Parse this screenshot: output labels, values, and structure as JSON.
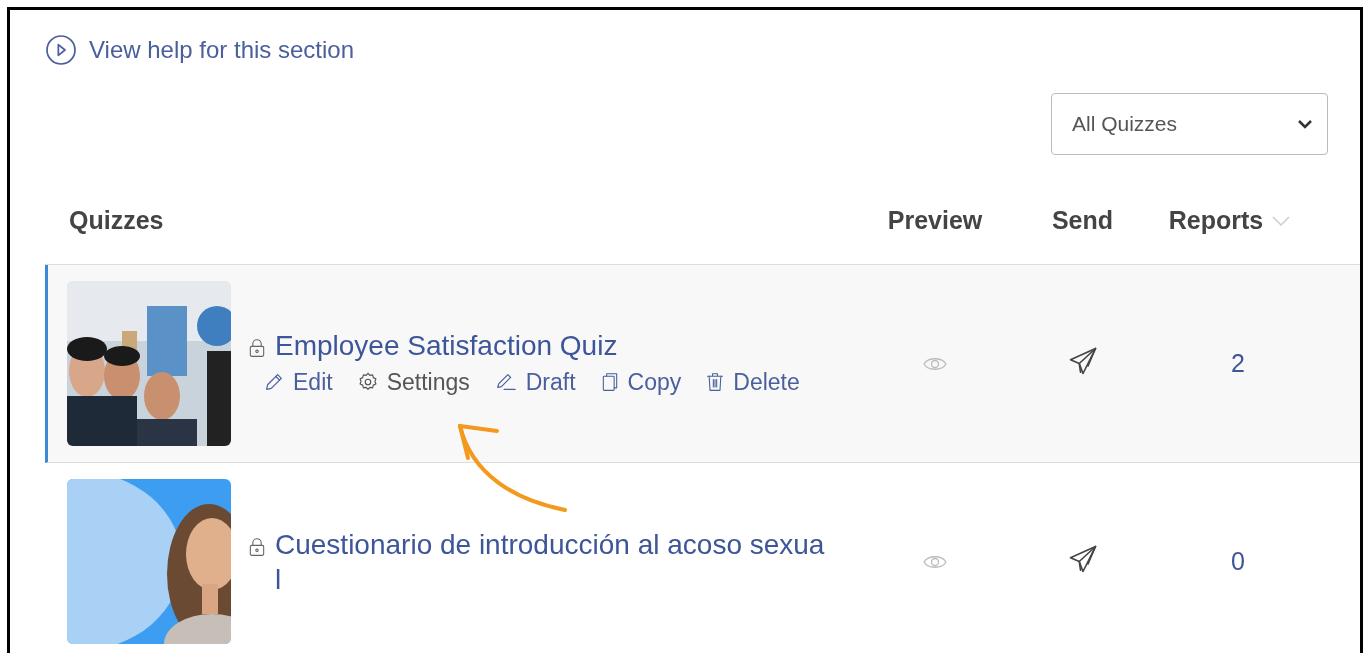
{
  "help_link": {
    "label": "View help for this section"
  },
  "filter": {
    "value": "All Quizzes"
  },
  "table": {
    "columns": [
      {
        "label": "Quizzes"
      },
      {
        "label": "Preview"
      },
      {
        "label": "Send"
      },
      {
        "label": "Reports",
        "sort_indicator": true
      }
    ],
    "rows": [
      {
        "title": "Employee Satisfaction Quiz",
        "locked": true,
        "selected": true,
        "actions": [
          {
            "kind": "edit",
            "label": "Edit",
            "selected": false
          },
          {
            "kind": "settings",
            "label": "Settings",
            "selected": true
          },
          {
            "kind": "draft",
            "label": "Draft",
            "selected": false
          },
          {
            "kind": "copy",
            "label": "Copy",
            "selected": false
          },
          {
            "kind": "delete",
            "label": "Delete",
            "selected": false
          }
        ],
        "reports": "2"
      },
      {
        "title": "Cuestionario de introducción al acoso sexual",
        "locked": true,
        "selected": false,
        "reports": "0"
      }
    ]
  },
  "annotations": [
    {
      "kind": "arrow"
    }
  ]
}
